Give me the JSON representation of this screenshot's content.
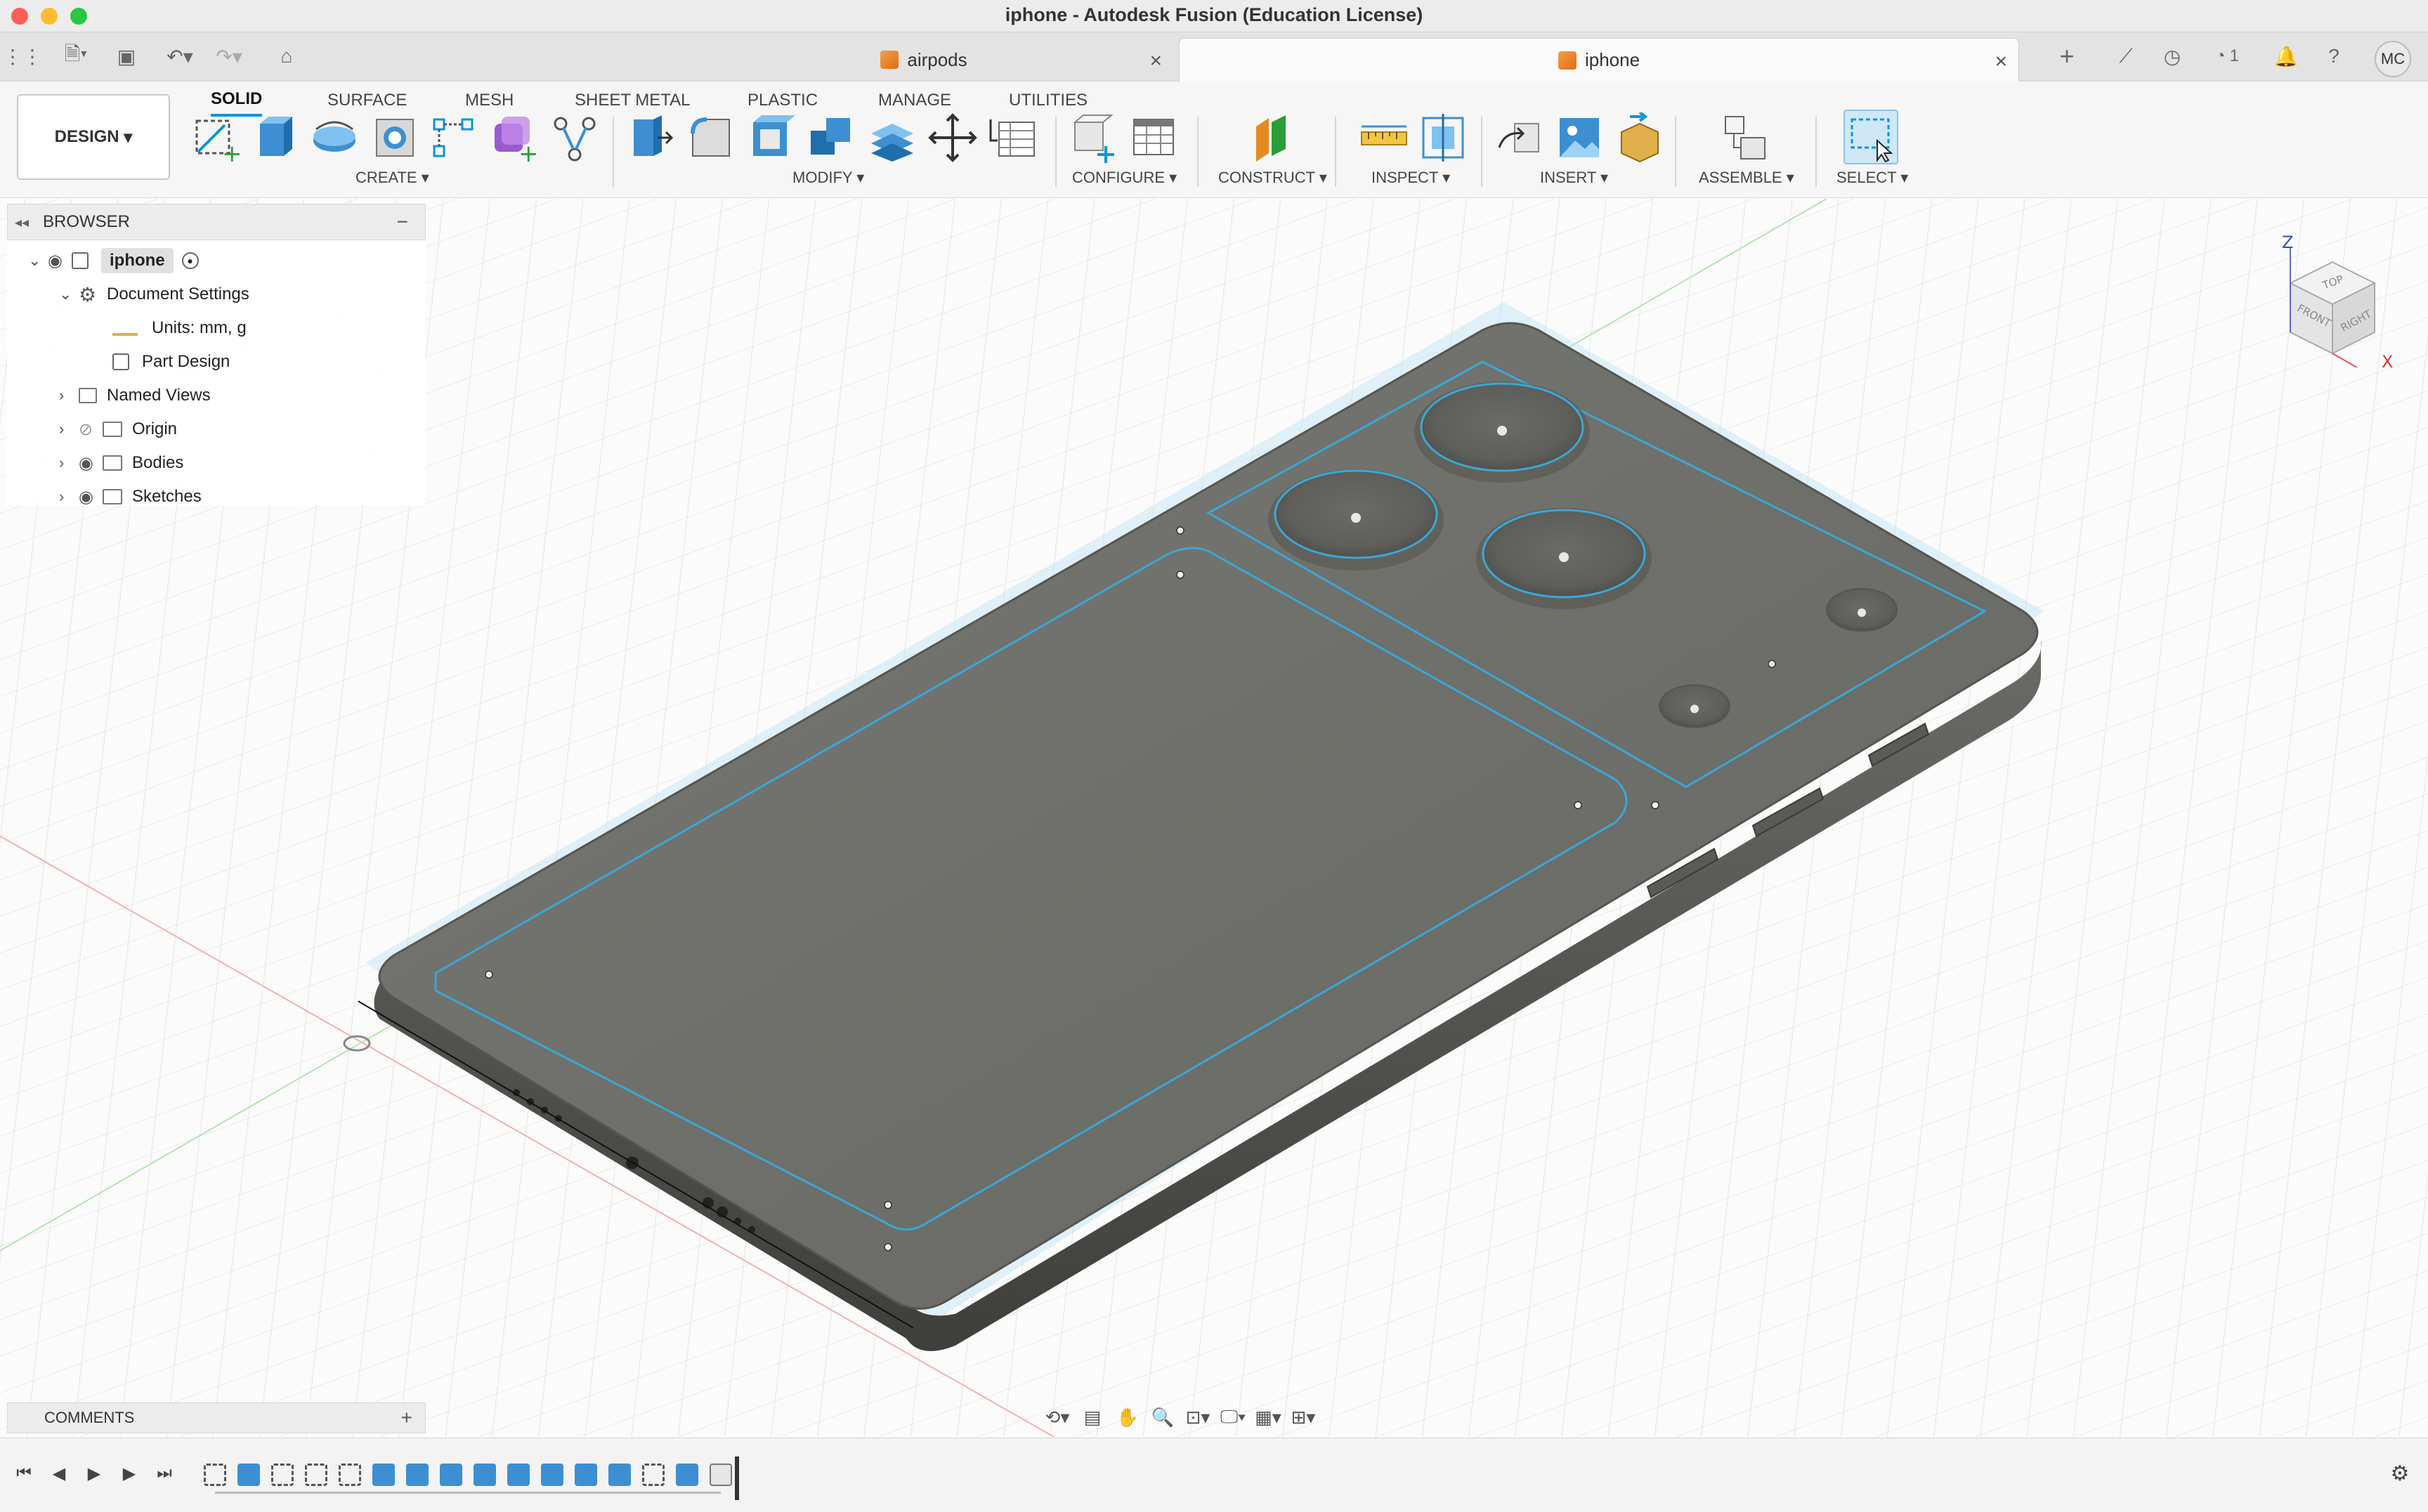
{
  "window": {
    "title": "iphone - Autodesk Fusion (Education License)"
  },
  "tabs": [
    {
      "label": "airpods",
      "active": false
    },
    {
      "label": "iphone",
      "active": true
    }
  ],
  "header_right": {
    "job_count": "1",
    "avatar_initials": "MC"
  },
  "toolbar": {
    "workspace_button": "DESIGN",
    "workspace_tabs": [
      "SOLID",
      "SURFACE",
      "MESH",
      "SHEET METAL",
      "PLASTIC",
      "MANAGE",
      "UTILITIES"
    ],
    "groups": {
      "create": "CREATE",
      "modify": "MODIFY",
      "configure": "CONFIGURE",
      "construct": "CONSTRUCT",
      "inspect": "INSPECT",
      "insert": "INSERT",
      "assemble": "ASSEMBLE",
      "select": "SELECT"
    }
  },
  "browser": {
    "title": "BROWSER",
    "root": "iphone",
    "document_settings": "Document Settings",
    "units": "Units: mm, g",
    "part_design": "Part Design",
    "named_views": "Named Views",
    "origin": "Origin",
    "bodies": "Bodies",
    "sketches": "Sketches"
  },
  "viewcube": {
    "top": "TOP",
    "front": "FRONT",
    "right": "RIGHT",
    "axis_z": "Z",
    "axis_x": "X"
  },
  "comments": {
    "title": "COMMENTS"
  },
  "colors": {
    "accent": "#0696d7",
    "body_gray": "#6f706b",
    "sketch_blue": "#3aa7d8"
  }
}
